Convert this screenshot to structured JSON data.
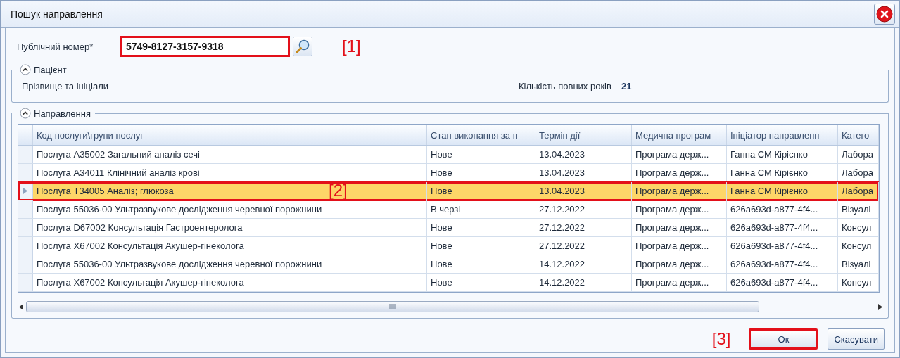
{
  "window": {
    "title": "Пошук направлення"
  },
  "public_number": {
    "label": "Публічний номер*",
    "value": "5749-8127-3157-9318",
    "callout": "[1]"
  },
  "patient_group": {
    "title": "Пацієнт",
    "expanded": true,
    "name_label": "Прізвище та ініціали",
    "age_label": "Кількість повних років",
    "age_value": "21"
  },
  "directions_group": {
    "title": "Направлення",
    "expanded": true
  },
  "table": {
    "columns": [
      "Код послуги\\групи послуг",
      "Стан виконання за п",
      "Термін дії",
      "Медична програм",
      "Ініціатор направленн",
      "Катего"
    ],
    "rows": [
      {
        "selected": false,
        "cells": [
          "Послуга A35002 Загальний аналіз сечі",
          "Нове",
          "13.04.2023",
          "Програма держ...",
          "Ганна СМ Кірієнко",
          "Лабора"
        ]
      },
      {
        "selected": false,
        "cells": [
          "Послуга A34011 Клінічний аналіз крові",
          "Нове",
          "13.04.2023",
          "Програма держ...",
          "Ганна СМ Кірієнко",
          "Лабора"
        ]
      },
      {
        "selected": true,
        "callout": "[2]",
        "cells": [
          "Послуга T34005 Аналіз; глюкоза",
          "Нове",
          "13.04.2023",
          "Програма держ...",
          "Ганна СМ Кірієнко",
          "Лабора"
        ]
      },
      {
        "selected": false,
        "cells": [
          "Послуга 55036-00 Ультразвукове дослідження черевної порожнини",
          "В черзі",
          "27.12.2022",
          "Програма держ...",
          "626a693d-a877-4f4...",
          "Візуалі"
        ]
      },
      {
        "selected": false,
        "cells": [
          "Послуга D67002 Консультація Гастроентеролога",
          "Нове",
          "27.12.2022",
          "Програма держ...",
          "626a693d-a877-4f4...",
          "Консул"
        ]
      },
      {
        "selected": false,
        "cells": [
          "Послуга X67002 Консультація Акушер-гінеколога",
          "Нове",
          "27.12.2022",
          "Програма держ...",
          "626a693d-a877-4f4...",
          "Консул"
        ]
      },
      {
        "selected": false,
        "cells": [
          "Послуга 55036-00 Ультразвукове дослідження черевної порожнини",
          "Нове",
          "14.12.2022",
          "Програма держ...",
          "626a693d-a877-4f4...",
          "Візуалі"
        ]
      },
      {
        "selected": false,
        "cells": [
          "Послуга X67002 Консультація Акушер-гінеколога",
          "Нове",
          "14.12.2022",
          "Програма держ...",
          "626a693d-a877-4f4...",
          "Консул"
        ]
      }
    ]
  },
  "buttons": [
    {
      "label": "Ок",
      "callout": "[3]"
    },
    {
      "label": "Скасувати"
    }
  ]
}
